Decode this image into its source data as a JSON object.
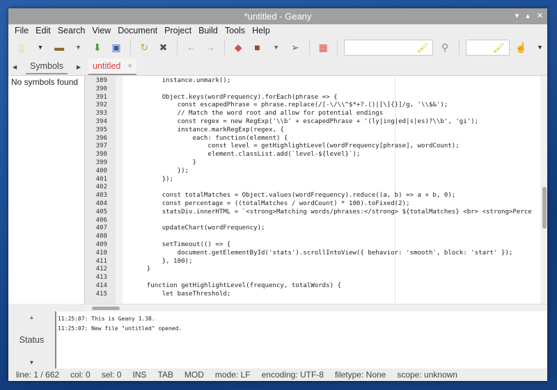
{
  "window": {
    "title": "*untitled - Geany"
  },
  "menu": [
    "File",
    "Edit",
    "Search",
    "View",
    "Document",
    "Project",
    "Build",
    "Tools",
    "Help"
  ],
  "toolbar": {
    "search_placeholder": "",
    "goto_placeholder": ""
  },
  "sidebar": {
    "tab_label": "Symbols",
    "empty_text": "No symbols found"
  },
  "editor_tab": {
    "label": "untitled",
    "close": "×"
  },
  "code": [
    {
      "n": "389",
      "t": "            instance.unmark();"
    },
    {
      "n": "390",
      "t": ""
    },
    {
      "n": "391",
      "t": "            Object.keys(wordFrequency).forEach(phrase => {"
    },
    {
      "n": "392",
      "t": "                const escapedPhrase = phrase.replace(/[-\\/\\\\^$*+?.()|[\\]{}]/g, '\\\\$&');"
    },
    {
      "n": "393",
      "t": "                // Match the word root and allow for potential endings"
    },
    {
      "n": "394",
      "t": "                const regex = new RegExp('\\\\b' + escapedPhrase + '(ly|ing|ed|s|es)?\\\\b', 'gi');"
    },
    {
      "n": "395",
      "t": "                instance.markRegExp(regex, {"
    },
    {
      "n": "396",
      "t": "                    each: function(element) {"
    },
    {
      "n": "397",
      "t": "                        const level = getHighlightLevel(wordFrequency[phrase], wordCount);"
    },
    {
      "n": "398",
      "t": "                        element.classList.add(`level-${level}`);"
    },
    {
      "n": "399",
      "t": "                    }"
    },
    {
      "n": "400",
      "t": "                });"
    },
    {
      "n": "401",
      "t": "            });"
    },
    {
      "n": "402",
      "t": ""
    },
    {
      "n": "403",
      "t": "            const totalMatches = Object.values(wordFrequency).reduce((a, b) => a + b, 0);"
    },
    {
      "n": "404",
      "t": "            const percentage = ((totalMatches / wordCount) * 100).toFixed(2);"
    },
    {
      "n": "405",
      "t": "            statsDiv.innerHTML = `<strong>Matching words/phrases:</strong> ${totalMatches} <br> <strong>Perce"
    },
    {
      "n": "406",
      "t": ""
    },
    {
      "n": "407",
      "t": "            updateChart(wordFrequency);"
    },
    {
      "n": "408",
      "t": ""
    },
    {
      "n": "409",
      "t": "            setTimeout(() => {"
    },
    {
      "n": "410",
      "t": "                document.getElementById('stats').scrollIntoView({ behavior: 'smooth', block: 'start' });"
    },
    {
      "n": "411",
      "t": "            }, 100);"
    },
    {
      "n": "412",
      "t": "        }"
    },
    {
      "n": "413",
      "t": ""
    },
    {
      "n": "414",
      "t": "        function getHighlightLevel(frequency, totalWords) {"
    },
    {
      "n": "415",
      "t": "            let baseThreshold;"
    }
  ],
  "messages": {
    "tab_label": "Status",
    "lines": [
      "11:25:07: This is Geany 1.38.",
      "11:25:07: New file \"untitled\" opened."
    ]
  },
  "statusbar": [
    "line: 1 / 662",
    "col: 0",
    "sel: 0",
    "INS",
    "TAB",
    "MOD",
    "mode: LF",
    "encoding: UTF-8",
    "filetype: None",
    "scope: unknown"
  ]
}
